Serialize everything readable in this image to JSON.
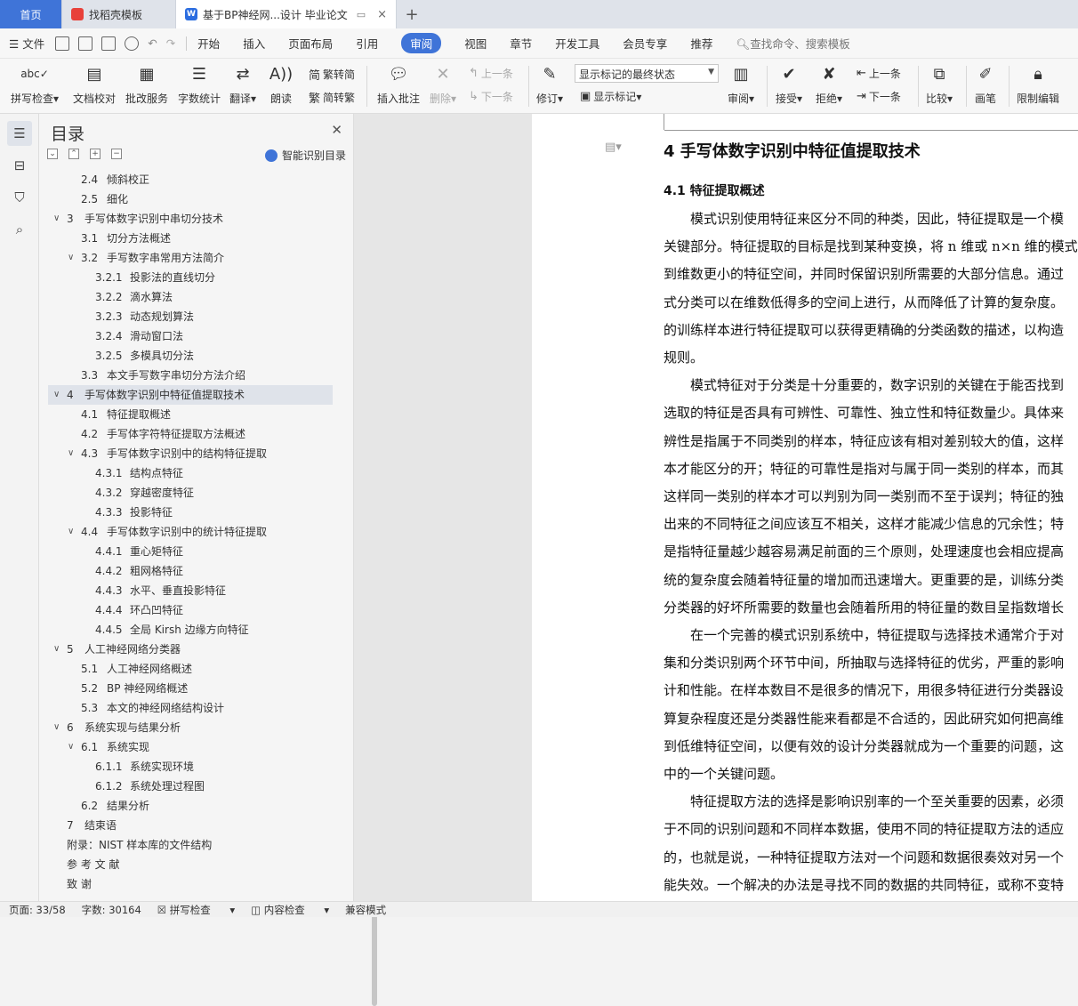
{
  "tabs": {
    "home": "首页",
    "template": "找稻壳模板",
    "doc": "基于BP神经网...设计 毕业论文"
  },
  "menu": {
    "file": "文件",
    "items": [
      "开始",
      "插入",
      "页面布局",
      "引用",
      "审阅",
      "视图",
      "章节",
      "开发工具",
      "会员专享",
      "推荐"
    ],
    "active": "审阅",
    "search": "查找命令、搜索模板"
  },
  "ribbon": {
    "spell": "拼写检查",
    "proof": "文档校对",
    "batch": "批改服务",
    "wordcount": "字数统计",
    "translate": "翻译",
    "read": "朗读",
    "trad": "繁转简",
    "simp": "简转繁",
    "comment": "插入批注",
    "delete": "删除",
    "prev_comment": "上一条",
    "next_comment": "下一条",
    "track": "修订",
    "status_combo": "显示标记的最终状态",
    "show_marks": "显示标记",
    "review": "审阅",
    "accept": "接受",
    "reject": "拒绝",
    "prev": "上一条",
    "next": "下一条",
    "compare": "比较",
    "pen": "画笔",
    "restrict": "限制编辑"
  },
  "toc": {
    "title": "目录",
    "smart": "智能识别目录",
    "items": [
      {
        "num": "2.4",
        "text": "倾斜校正",
        "level": 2
      },
      {
        "num": "2.5",
        "text": "细化",
        "level": 2
      },
      {
        "num": "3",
        "text": "手写体数字识别中串切分技术",
        "level": 1,
        "expand": "v"
      },
      {
        "num": "3.1",
        "text": "切分方法概述",
        "level": 2
      },
      {
        "num": "3.2",
        "text": "手写数字串常用方法简介",
        "level": 2,
        "expand": "v"
      },
      {
        "num": "3.2.1",
        "text": "投影法的直线切分",
        "level": 3
      },
      {
        "num": "3.2.2",
        "text": "滴水算法",
        "level": 3
      },
      {
        "num": "3.2.3",
        "text": "动态规划算法",
        "level": 3
      },
      {
        "num": "3.2.4",
        "text": "滑动窗口法",
        "level": 3
      },
      {
        "num": "3.2.5",
        "text": "多模具切分法",
        "level": 3
      },
      {
        "num": "3.3",
        "text": "本文手写数字串切分方法介绍",
        "level": 2
      },
      {
        "num": "4",
        "text": "手写体数字识别中特征值提取技术",
        "level": 1,
        "expand": "v",
        "selected": true
      },
      {
        "num": "4.1",
        "text": "特征提取概述",
        "level": 2
      },
      {
        "num": "4.2",
        "text": "手写体字符特征提取方法概述",
        "level": 2
      },
      {
        "num": "4.3",
        "text": "手写体数字识别中的结构特征提取",
        "level": 2,
        "expand": "v"
      },
      {
        "num": "4.3.1",
        "text": "结构点特征",
        "level": 3
      },
      {
        "num": "4.3.2",
        "text": "穿越密度特征",
        "level": 3
      },
      {
        "num": "4.3.3",
        "text": "投影特征",
        "level": 3
      },
      {
        "num": "4.4",
        "text": "手写体数字识别中的统计特征提取",
        "level": 2,
        "expand": "v"
      },
      {
        "num": "4.4.1",
        "text": "重心矩特征",
        "level": 3
      },
      {
        "num": "4.4.2",
        "text": "粗网格特征",
        "level": 3
      },
      {
        "num": "4.4.3",
        "text": "水平、垂直投影特征",
        "level": 3
      },
      {
        "num": "4.4.4",
        "text": "环凸凹特征",
        "level": 3
      },
      {
        "num": "4.4.5",
        "text": "全局 Kirsh 边缘方向特征",
        "level": 3
      },
      {
        "num": "5",
        "text": "人工神经网络分类器",
        "level": 1,
        "expand": "v"
      },
      {
        "num": "5.1",
        "text": "人工神经网络概述",
        "level": 2
      },
      {
        "num": "5.2",
        "text": "BP 神经网络概述",
        "level": 2
      },
      {
        "num": "5.3",
        "text": "本文的神经网络结构设计",
        "level": 2
      },
      {
        "num": "6",
        "text": "系统实现与结果分析",
        "level": 1,
        "expand": "v"
      },
      {
        "num": "6.1",
        "text": "系统实现",
        "level": 2,
        "expand": "v"
      },
      {
        "num": "6.1.1",
        "text": "系统实现环境",
        "level": 3
      },
      {
        "num": "6.1.2",
        "text": "系统处理过程图",
        "level": 3
      },
      {
        "num": "6.2",
        "text": "结果分析",
        "level": 2
      },
      {
        "num": "7",
        "text": "结束语",
        "level": 1
      },
      {
        "num": "",
        "text": "附录：NIST 样本库的文件结构",
        "level": 1
      },
      {
        "num": "",
        "text": "参 考 文 献",
        "level": 1
      },
      {
        "num": "",
        "text": "致    谢",
        "level": 1
      }
    ]
  },
  "document": {
    "heading1": "4    手写体数字识别中特征值提取技术",
    "heading2": "4.1    特征提取概述",
    "lines": [
      "　　模式识别使用特征来区分不同的种类，因此，特征提取是一个模",
      "关键部分。特征提取的目标是找到某种变换，将 n 维或 n×n 维的模式",
      "到维数更小的特征空间，并同时保留识别所需要的大部分信息。通过",
      "式分类可以在维数低得多的空间上进行，从而降低了计算的复杂度。",
      "的训练样本进行特征提取可以获得更精确的分类函数的描述，以构造",
      "规则。",
      "　　模式特征对于分类是十分重要的，数字识别的关键在于能否找到",
      "选取的特征是否具有可辨性、可靠性、独立性和特征数量少。具体来",
      "辨性是指属于不同类别的样本，特征应该有相对差别较大的值，这样",
      "本才能区分的开；特征的可靠性是指对与属于同一类别的样本，而其",
      "这样同一类别的样本才可以判别为同一类别而不至于误判；特征的独",
      "出来的不同特征之间应该互不相关，这样才能减少信息的冗余性；特",
      "是指特征量越少越容易满足前面的三个原则，处理速度也会相应提高",
      "统的复杂度会随着特征量的增加而迅速增大。更重要的是，训练分类",
      "分类器的好坏所需要的数量也会随着所用的特征量的数目呈指数增长",
      "　　在一个完善的模式识别系统中，特征提取与选择技术通常介于对",
      "集和分类识别两个环节中间，所抽取与选择特征的优劣，严重的影响",
      "计和性能。在样本数目不是很多的情况下，用很多特征进行分类器设",
      "算复杂程度还是分类器性能来看都是不合适的，因此研究如何把高维",
      "到低维特征空间，以便有效的设计分类器就成为一个重要的问题，这",
      "中的一个关键问题。",
      "　　特征提取方法的选择是影响识别率的一个至关重要的因素，必须",
      "于不同的识别问题和不同样本数据，使用不同的特征提取方法的适应",
      "的，也就是说，一种特征提取方法对一个问题和数据很奏效对另一个",
      "能失效。一个解决的办法是寻找不同的数据的共同特征，或称不变特"
    ]
  },
  "status": {
    "page": "页面: 33/58",
    "words": "字数: 30164",
    "spell": "拼写检查",
    "content": "内容检查",
    "compat": "兼容模式"
  },
  "colors": {
    "accent": "#3f74d8",
    "selected_row": "#dfe3ea"
  }
}
